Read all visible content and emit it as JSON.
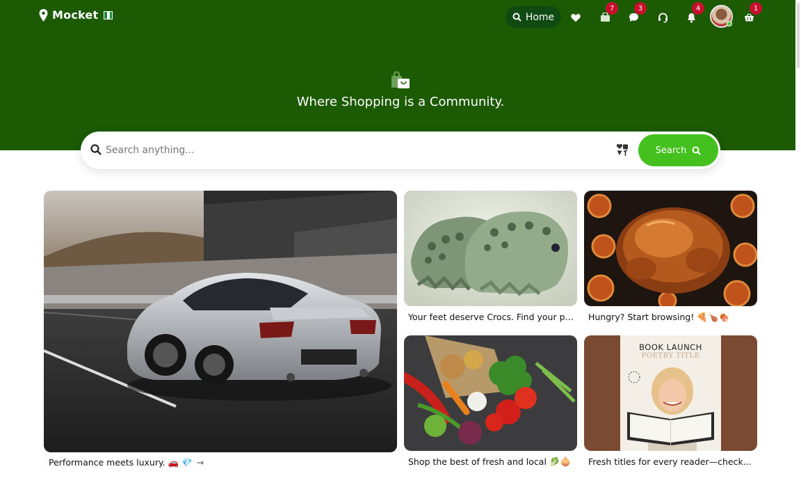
{
  "header": {
    "brand": "Mocket",
    "home_label": "Home",
    "badges": {
      "shop": "7",
      "messages": "3",
      "notifications": "4",
      "cart": "1"
    },
    "icons": [
      "location-pin-icon",
      "search-icon",
      "heart-icon",
      "shop-icon",
      "chat-icon",
      "support-icon",
      "bell-icon",
      "cart-icon"
    ]
  },
  "hero": {
    "tagline": "Where Shopping is a Community."
  },
  "search": {
    "placeholder": "Search anything...",
    "button_label": "Search"
  },
  "cards": [
    {
      "caption": "Performance meets luxury. 🚗 💎"
    },
    {
      "caption": "Your feet deserve Crocs. Find your pai..."
    },
    {
      "caption": "Hungry? Start browsing! 🍕🍗🍖"
    },
    {
      "caption": "Shop the best of fresh and local 🥬🧅"
    },
    {
      "caption": "Fresh titles for every reader—check...",
      "book_title": "BOOK LAUNCH",
      "book_subtitle": "POETRY TITLE"
    }
  ],
  "colors": {
    "header_bg": "#1c5a04",
    "accent": "#44c01f",
    "badge": "#c8102e"
  }
}
